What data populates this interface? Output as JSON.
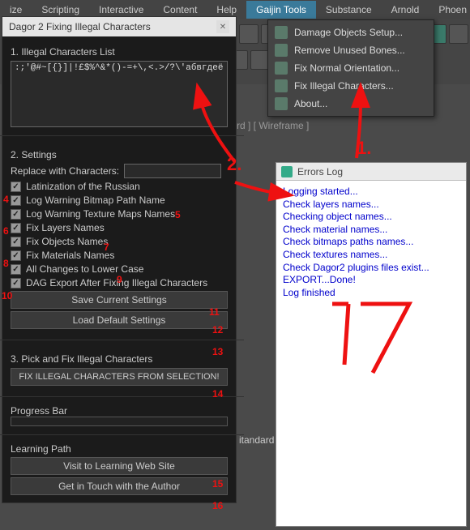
{
  "menubar": {
    "items": [
      "ize",
      "Scripting",
      "Interactive",
      "Content",
      "Help",
      "Gaijin Tools",
      "Substance",
      "Arnold",
      "Phoen"
    ],
    "active_index": 5
  },
  "dialog": {
    "title": "Dagor 2 Fixing Illegal Characters",
    "sec1": "1. Illegal Characters List",
    "chars": ":;'@#~[{}]|!£$%^&*()-=+\\,<.>/?\\'абвгдеё",
    "sec2": "2. Settings",
    "replace_label": "Replace with Characters:",
    "cb": [
      "Latinization of the Russian",
      "Log Warning Bitmap Path Name",
      "Log Warning Texture Maps Names",
      "Fix Layers Names",
      "Fix Objects Names",
      "Fix Materials Names",
      "All Changes to Lower Case",
      "DAG Export After Fixing Illegal Characters"
    ],
    "btn_save": "Save Current Settings",
    "btn_load": "Load Default Settings",
    "sec3": "3. Pick and Fix Illegal Characters",
    "btn_fix": "FIX ILLEGAL CHARACTERS FROM SELECTION!",
    "progress_label": "Progress Bar",
    "learn_label": "Learning Path",
    "btn_visit": "Visit to Learning Web Site",
    "btn_author": "Get in Touch with the Author"
  },
  "dropdown": {
    "items": [
      "Damage Objects Setup...",
      "Remove Unused Bones...",
      "Fix Normal Orientation...",
      "Fix Illegal Characters...",
      "About..."
    ]
  },
  "log": {
    "title": "Errors Log",
    "lines": [
      "Logging started...",
      "Check layers names...",
      "Checking object names...",
      "Check material names...",
      "Check bitmaps paths names...",
      "Check textures names...",
      "Check Dagor2 plugins files exist...",
      "EXPORT...Done!",
      "Log finished"
    ]
  },
  "viewport": {
    "wireframe": "rd ] [ Wireframe ]",
    "standard": "itandard ]"
  },
  "annotations": {
    "a1": "1.",
    "a2": "2.",
    "a4": "4",
    "a5": "5",
    "a6": "6",
    "a7": "7",
    "a8": "8",
    "a9": "9",
    "a10": "10",
    "a11": "11",
    "a12": "12",
    "a13": "13",
    "a14": "14",
    "a15": "15",
    "a16": "16",
    "a17": "17"
  }
}
